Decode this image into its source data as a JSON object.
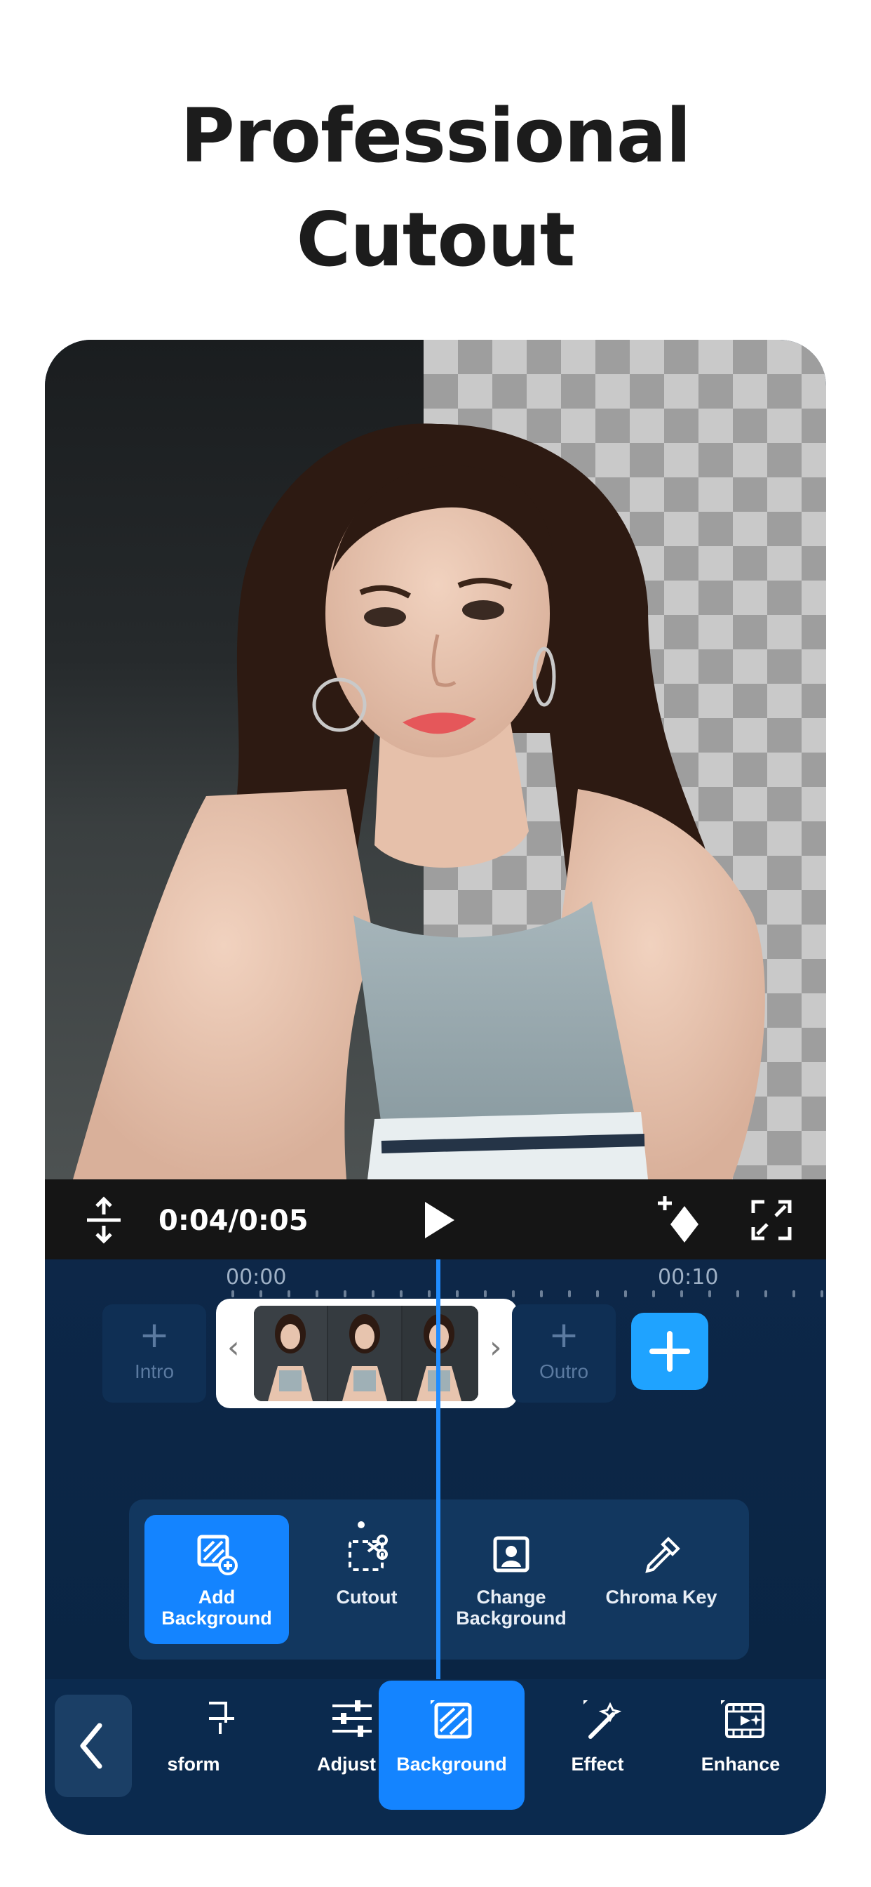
{
  "headline": {
    "line1": "Professional",
    "line2": "Cutout"
  },
  "player": {
    "time": "0:04/0:05"
  },
  "timeline": {
    "ruler": [
      "00:00",
      "00:10"
    ],
    "intro_label": "Intro",
    "outro_label": "Outro",
    "plus_glyph": "+",
    "clip_left_arrow": "‹",
    "clip_right_arrow": "›"
  },
  "background_panel": {
    "options": [
      {
        "label_line1": "Add",
        "label_line2": "Background",
        "active": true
      },
      {
        "label_line1": "Cutout",
        "label_line2": "",
        "active": false
      },
      {
        "label_line1": "Change",
        "label_line2": "Background",
        "active": false
      },
      {
        "label_line1": "Chroma Key",
        "label_line2": "",
        "active": false
      }
    ]
  },
  "toolbar": {
    "items": [
      {
        "label": "sform",
        "icon": "transform-icon",
        "active": false
      },
      {
        "label": "Adjust",
        "icon": "sliders-icon",
        "active": false
      },
      {
        "label": "Background",
        "icon": "background-icon",
        "active": true
      },
      {
        "label": "Effect",
        "icon": "magic-wand-icon",
        "active": false
      },
      {
        "label": "Enhance",
        "icon": "film-enhance-icon",
        "active": false
      }
    ]
  },
  "colors": {
    "accent": "#1484ff",
    "timeline_bg": "#0d2748",
    "panel_bg": "#12375f",
    "add_clip": "#1fa3ff",
    "playhead": "#1f8cff"
  }
}
